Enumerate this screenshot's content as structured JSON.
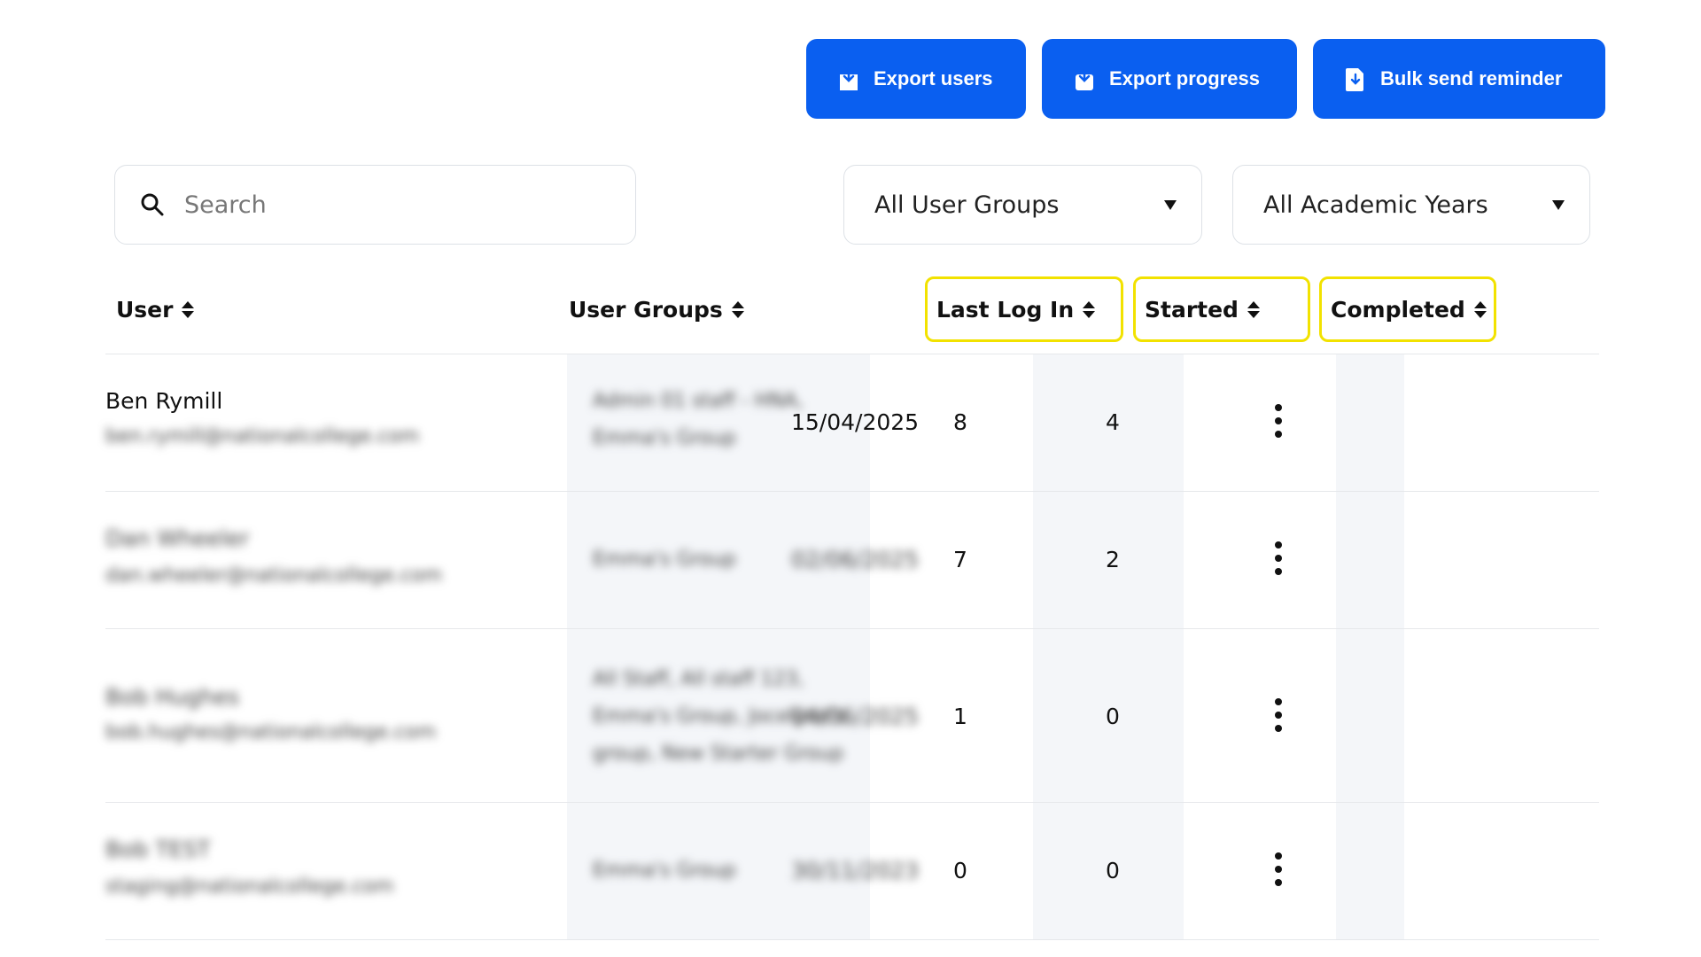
{
  "actions": {
    "export_users": "Export users",
    "export_progress": "Export progress",
    "bulk_send": "Bulk send reminder"
  },
  "filters": {
    "search_placeholder": "Search",
    "user_groups": "All User Groups",
    "academic_years": "All Academic Years"
  },
  "columns": {
    "user": "User",
    "user_groups": "User Groups",
    "last_login": "Last Log In",
    "started": "Started",
    "completed": "Completed"
  },
  "rows": [
    {
      "name": "Ben Rymill",
      "email": "ben.rymill@nationalcollege.com",
      "groups": "Admin 01 staff - HNA, Emma's Group",
      "last_login": "15/04/2025",
      "started": "8",
      "completed": "4"
    },
    {
      "name": "Dan Wheeler",
      "email": "dan.wheeler@nationalcollege.com",
      "groups": "Emma's Group",
      "last_login": "02/06/2025",
      "started": "7",
      "completed": "2"
    },
    {
      "name": "Bob Hughes",
      "email": "bob.hughes@nationalcollege.com",
      "groups": "All Staff, All staff 123, Emma's Group, Jocelyne's group, New Starter Group",
      "last_login": "04/06/2025",
      "started": "1",
      "completed": "0"
    },
    {
      "name": "Bob TEST",
      "email": "staging@nationalcollege.com",
      "groups": "Emma's Group",
      "last_login": "30/11/2023",
      "started": "0",
      "completed": "0"
    }
  ],
  "colors": {
    "primary": "#0a5ff0",
    "highlight": "#f2e200",
    "shade": "#f4f6f9"
  }
}
